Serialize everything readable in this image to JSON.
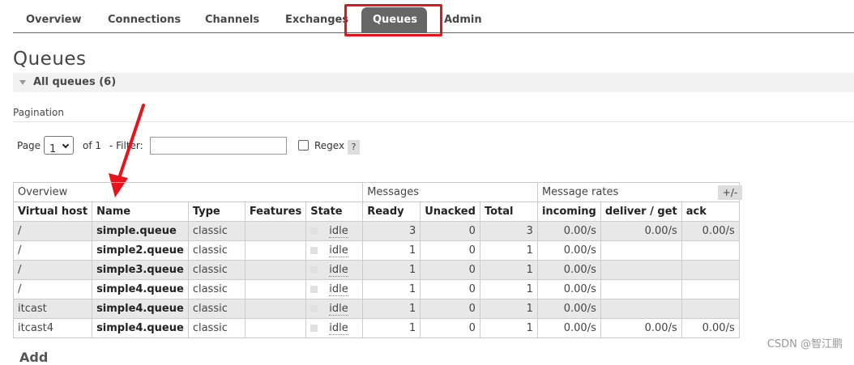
{
  "nav": {
    "items": [
      {
        "label": "Overview"
      },
      {
        "label": "Connections"
      },
      {
        "label": "Channels"
      },
      {
        "label": "Exchanges"
      },
      {
        "label": "Queues",
        "active": true
      },
      {
        "label": "Admin"
      }
    ]
  },
  "page": {
    "title": "Queues",
    "section_title": "All queues (6)"
  },
  "pagination": {
    "label": "Pagination",
    "page_label": "Page",
    "page_value": "1",
    "of_label": "of 1",
    "filter_label": "- Filter:",
    "filter_value": "",
    "regex_label": "Regex",
    "help_label": "?"
  },
  "table": {
    "group_headers": [
      "Overview",
      "Messages",
      "Message rates"
    ],
    "columns": [
      "Virtual host",
      "Name",
      "Type",
      "Features",
      "State",
      "Ready",
      "Unacked",
      "Total",
      "incoming",
      "deliver / get",
      "ack"
    ],
    "plus_minus": "+/-",
    "rows": [
      {
        "vhost": "/",
        "name": "simple.queue",
        "type": "classic",
        "features": "",
        "state": "idle",
        "ready": "3",
        "unacked": "0",
        "total": "3",
        "incoming": "0.00/s",
        "deliver": "0.00/s",
        "ack": "0.00/s"
      },
      {
        "vhost": "/",
        "name": "simple2.queue",
        "type": "classic",
        "features": "",
        "state": "idle",
        "ready": "1",
        "unacked": "0",
        "total": "1",
        "incoming": "0.00/s",
        "deliver": "",
        "ack": ""
      },
      {
        "vhost": "/",
        "name": "simple3.queue",
        "type": "classic",
        "features": "",
        "state": "idle",
        "ready": "1",
        "unacked": "0",
        "total": "1",
        "incoming": "0.00/s",
        "deliver": "",
        "ack": ""
      },
      {
        "vhost": "/",
        "name": "simple4.queue",
        "type": "classic",
        "features": "",
        "state": "idle",
        "ready": "1",
        "unacked": "0",
        "total": "1",
        "incoming": "0.00/s",
        "deliver": "",
        "ack": ""
      },
      {
        "vhost": "itcast",
        "name": "simple4.queue",
        "type": "classic",
        "features": "",
        "state": "idle",
        "ready": "1",
        "unacked": "0",
        "total": "1",
        "incoming": "0.00/s",
        "deliver": "",
        "ack": ""
      },
      {
        "vhost": "itcast4",
        "name": "simple4.queue",
        "type": "classic",
        "features": "",
        "state": "idle",
        "ready": "1",
        "unacked": "0",
        "total": "1",
        "incoming": "0.00/s",
        "deliver": "0.00/s",
        "ack": "0.00/s"
      }
    ]
  },
  "watermark": "CSDN @智江鹏",
  "cutoff_text": "Add",
  "colors": {
    "active_tab": "#666666",
    "highlight": "#e8121b",
    "row_alt": "#e8e8e8"
  }
}
